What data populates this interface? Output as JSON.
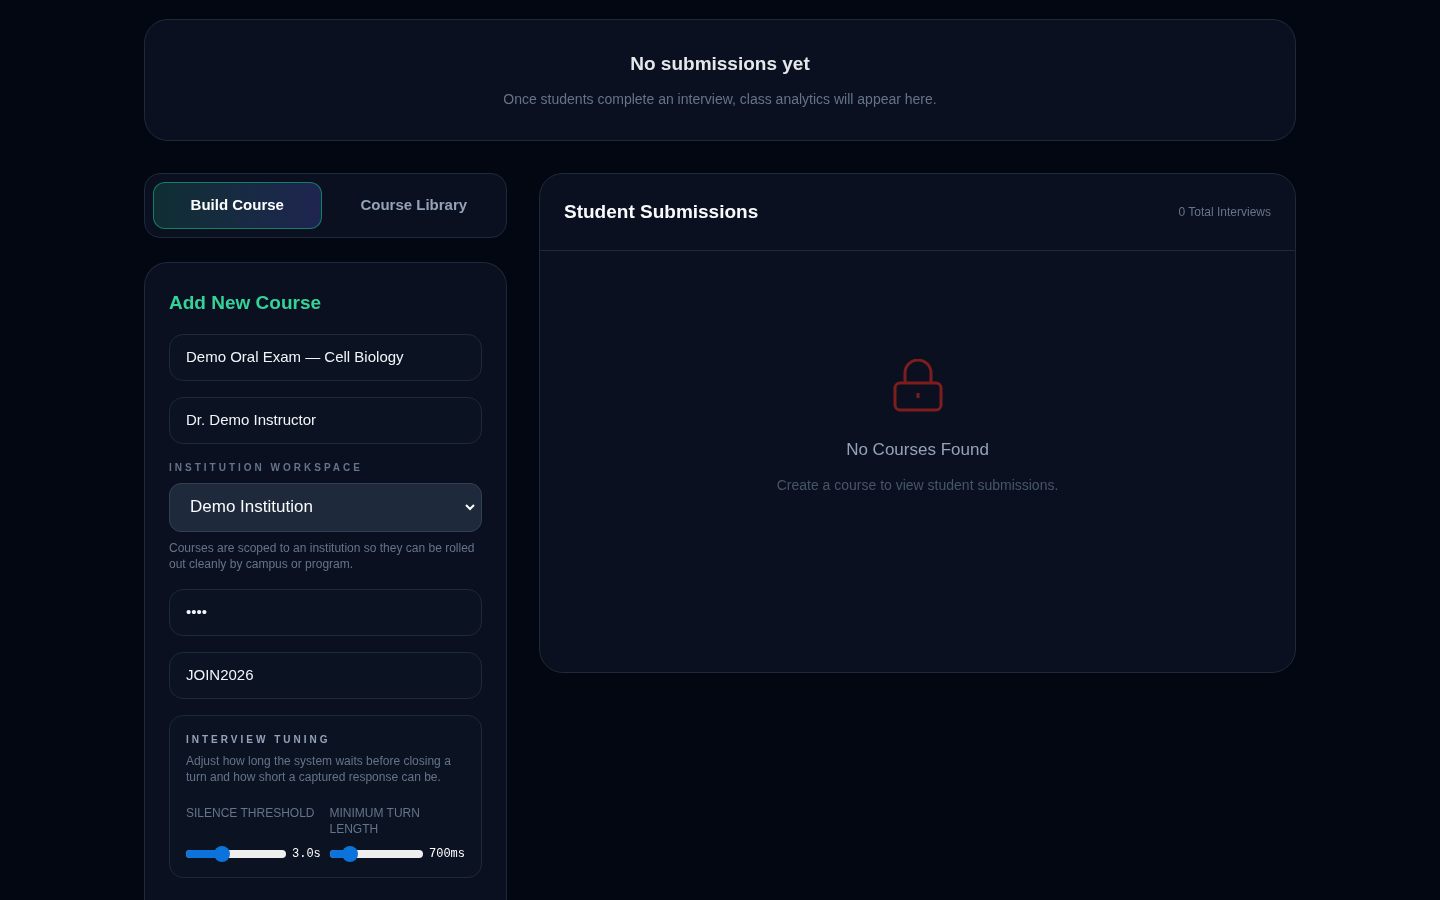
{
  "analytics_empty": {
    "title": "No submissions yet",
    "message": "Once students complete an interview, class analytics will appear here."
  },
  "tabs": [
    {
      "label": "Build Course",
      "selected": true
    },
    {
      "label": "Course Library",
      "selected": false
    }
  ],
  "course_form": {
    "title": "Add New Course",
    "course_name": {
      "value": "Demo Oral Exam — Cell Biology"
    },
    "instructor": {
      "value": "Dr. Demo Instructor"
    },
    "workspace_label": "INSTITUTION WORKSPACE",
    "workspace_select": {
      "value": "Demo Institution"
    },
    "workspace_hint": "Courses are scoped to an institution so they can be rolled out cleanly by campus or program.",
    "password": {
      "value": "••••"
    },
    "join_code": {
      "value": "JOIN2026"
    },
    "tuning": {
      "title": "INTERVIEW TUNING",
      "description": "Adjust how long the system waits before closing a turn and how short a captured response can be.",
      "sliders": [
        {
          "label": "SILENCE THRESHOLD",
          "level": 0.3,
          "reading": "3.0s"
        },
        {
          "label": "MINIMUM TURN LENGTH",
          "level": 0.16,
          "reading": "700ms"
        }
      ]
    }
  },
  "submissions": {
    "title": "Student Submissions",
    "count": "0 Total Interviews",
    "empty_title": "No Courses Found",
    "empty_message": "Create a course to view student submissions."
  }
}
